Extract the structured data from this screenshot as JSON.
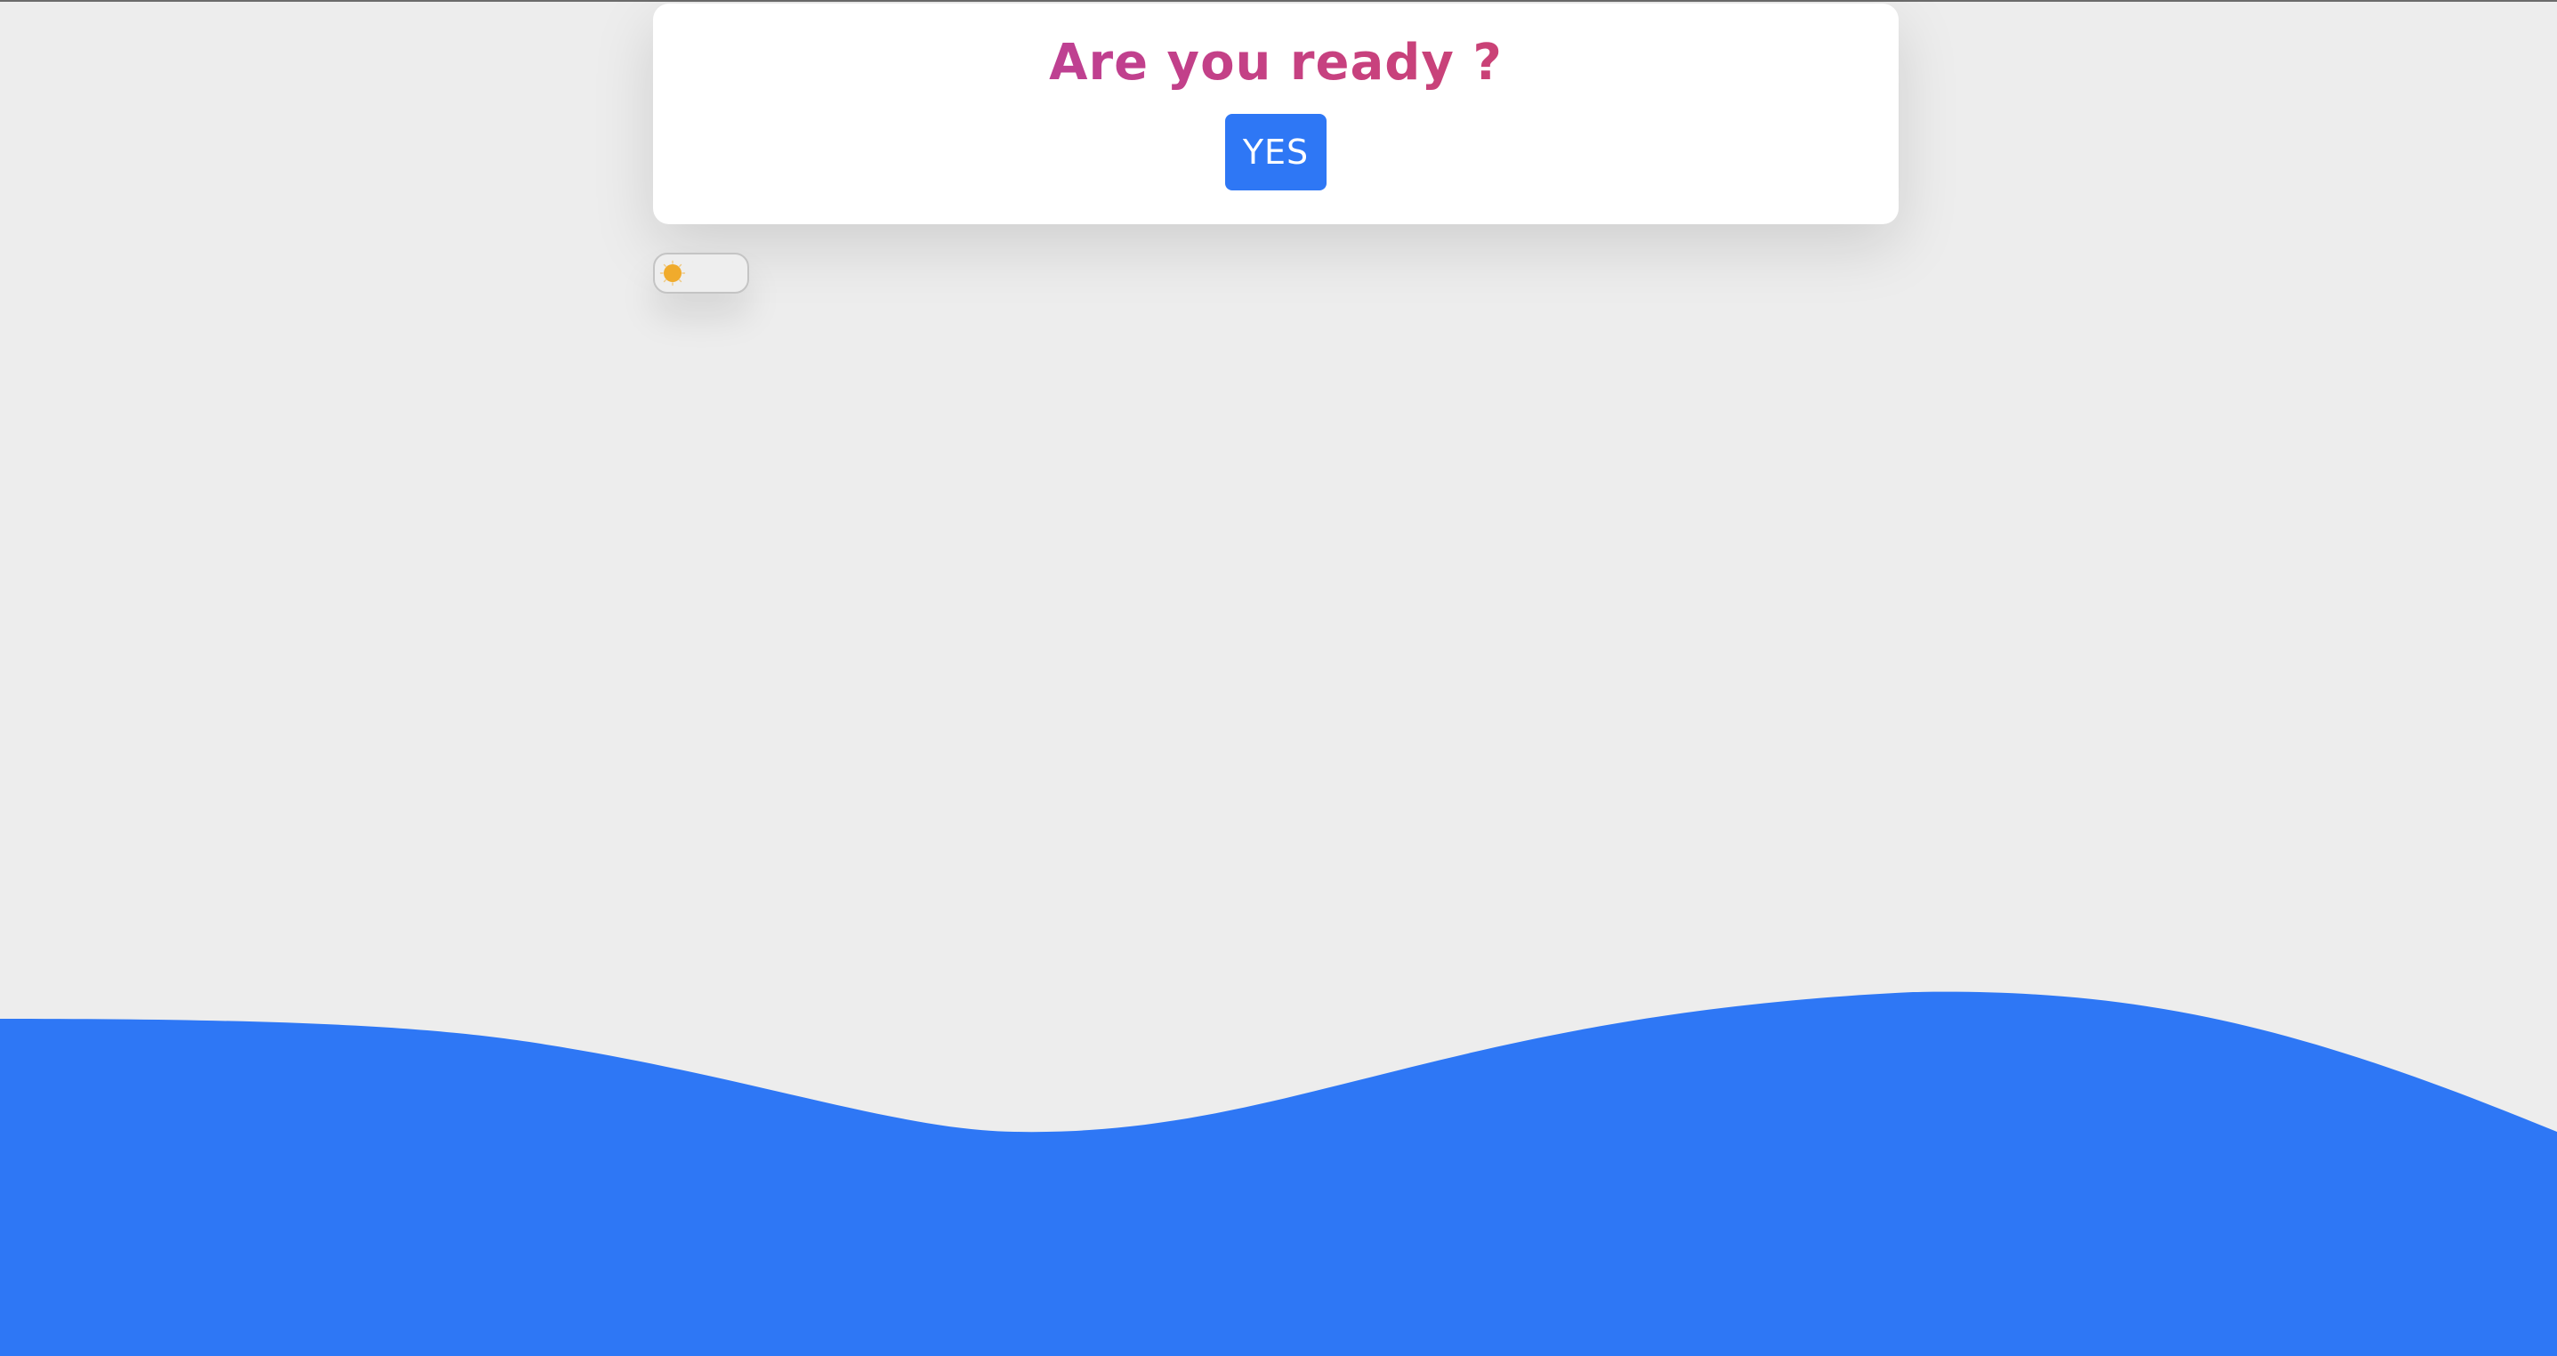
{
  "prompt": {
    "title": "Are you ready ?",
    "confirm_label": "YES"
  },
  "theme_toggle": {
    "mode": "light",
    "icon": "sun-icon"
  },
  "colors": {
    "background": "#ededed",
    "card": "#ffffff",
    "accent": "#2e77f5",
    "title_gradient_start": "#b23fae",
    "title_gradient_end": "#d04460",
    "sun": "#f0ab2c"
  }
}
